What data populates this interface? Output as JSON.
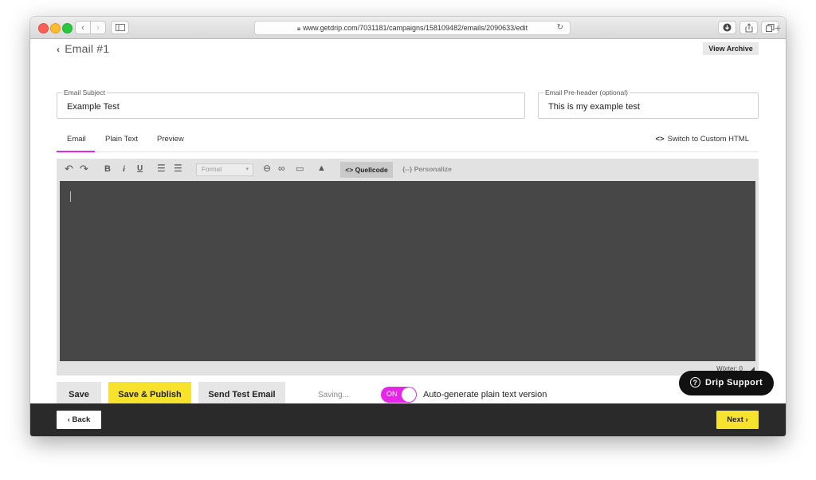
{
  "browser": {
    "url": "www.getdrip.com/7031181/campaigns/158109482/emails/2090633/edit",
    "nav_back": "‹",
    "nav_forward": "›",
    "new_tab": "+"
  },
  "header": {
    "back_label": "Email #1",
    "view_archive": "View Archive"
  },
  "fields": {
    "subject_label": "Email Subject",
    "subject_value": "Example Test",
    "preheader_label": "Email Pre-header (optional)",
    "preheader_value": "This is my example test"
  },
  "tabs": [
    "Email",
    "Plain Text",
    "Preview"
  ],
  "switch_html": "Switch to Custom HTML",
  "toolbar": {
    "format_placeholder": "Format",
    "source": "Quellcode",
    "personalize": "{--} Personalize"
  },
  "editor": {
    "word_count": "Wörter: 0"
  },
  "actions": {
    "save": "Save",
    "save_publish": "Save & Publish",
    "send_test": "Send Test Email",
    "status": "Saving...",
    "toggle_state": "ON",
    "autogen_label": "Auto-generate plain text version"
  },
  "footer": {
    "back": "Back",
    "next": "Next"
  },
  "support": {
    "label": "Drip Support"
  },
  "colors": {
    "accent_magenta": "#e626e6",
    "primary_yellow": "#f7e22e",
    "editor_bg": "#474747",
    "footer_bg": "#2a2a2a"
  }
}
